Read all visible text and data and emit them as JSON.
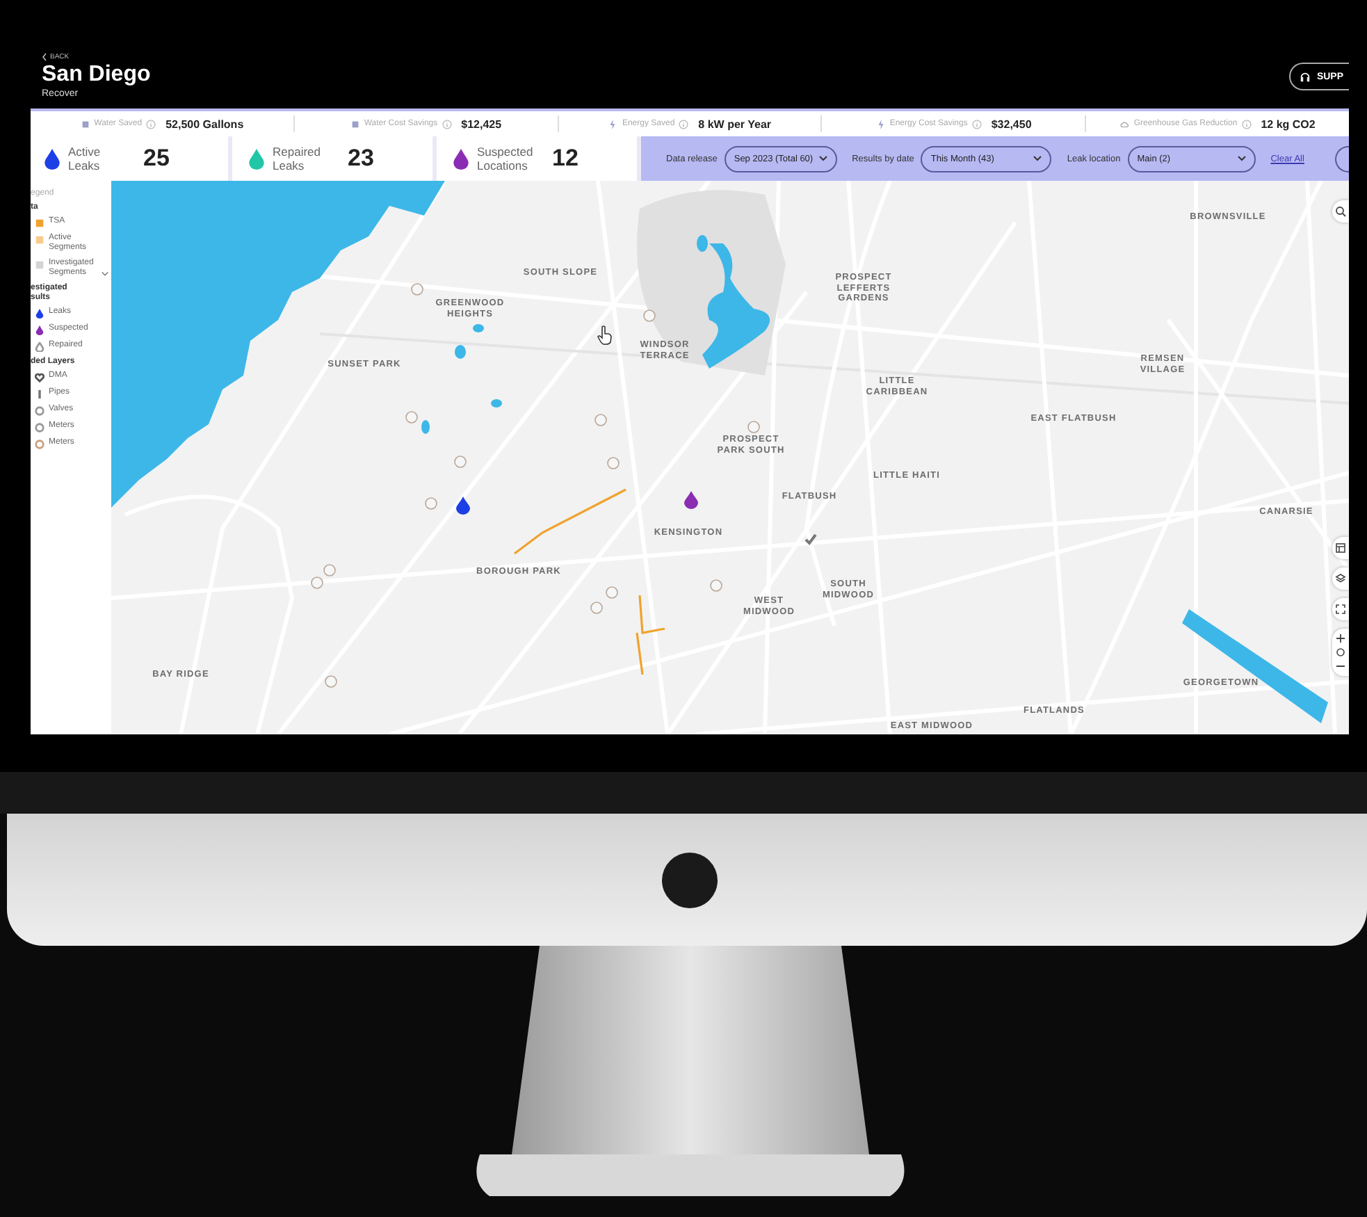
{
  "header": {
    "back_label": "BACK",
    "title": "San Diego",
    "subtitle": "Recover",
    "support_label": "SUPP"
  },
  "stats": [
    {
      "kind": "square",
      "label": "Water Saved",
      "value": "52,500 Gallons"
    },
    {
      "kind": "square",
      "label": "Water Cost Savings",
      "value": "$12,425"
    },
    {
      "kind": "bolt",
      "label": "Energy Saved",
      "value": "8 kW per Year"
    },
    {
      "kind": "bolt",
      "label": "Energy Cost Savings",
      "value": "$32,450"
    },
    {
      "kind": "cloud",
      "label": "Greenhouse Gas Reduction",
      "value": "12 kg CO2"
    }
  ],
  "counts": [
    {
      "label": "Active Leaks",
      "value": "25",
      "color": "#1d3fe6"
    },
    {
      "label": "Repaired Leaks",
      "value": "23",
      "color": "#1fc7a6"
    },
    {
      "label": "Suspected Locations",
      "value": "12",
      "color": "#8a2db3"
    }
  ],
  "filters": [
    {
      "label": "Data release",
      "value": "Sep 2023 (Total 60)"
    },
    {
      "label": "Results by date",
      "value": "This Month (43)"
    },
    {
      "label": "Leak location",
      "value": "Main (2)"
    }
  ],
  "clear_label": "Clear All",
  "legend": {
    "title": "egend",
    "sections": [
      {
        "heading": "ta",
        "items": [
          {
            "kind": "swatch",
            "label": "TSA",
            "color": "#f0a22e"
          },
          {
            "kind": "swatch",
            "label": "Active Segments",
            "color": "#f6cc8c"
          },
          {
            "kind": "swatch",
            "label": "Investigated Segments",
            "color": "#d4d4d4",
            "expandable": true
          }
        ]
      },
      {
        "heading": "estigated sults",
        "items": [
          {
            "kind": "drop",
            "label": "Leaks",
            "color": "#1d3fe6"
          },
          {
            "kind": "drop",
            "label": "Suspected",
            "color": "#8a2db3"
          },
          {
            "kind": "drop-outline",
            "label": "Repaired",
            "color": "#9a9a9a"
          }
        ]
      },
      {
        "heading": "ded Layers",
        "items": [
          {
            "kind": "outline",
            "label": "DMA",
            "color": "#555555"
          },
          {
            "kind": "pipe",
            "label": "Pipes",
            "color": "#777777"
          },
          {
            "kind": "circle",
            "label": "Valves",
            "color": "#999999"
          },
          {
            "kind": "circle",
            "label": "Meters",
            "color": "#999999"
          },
          {
            "kind": "circle",
            "label": "Meters",
            "color": "#c9a080"
          }
        ]
      }
    ]
  },
  "map": {
    "labels": [
      "SOUTH SLOPE",
      "GREENWOOD HEIGHTS",
      "SUNSET PARK",
      "WINDSOR TERRACE",
      "PROSPECT LEFFERTS GARDENS",
      "BROWNSVILLE",
      "REMSEN VILLAGE",
      "LITTLE CARIBBEAN",
      "EAST FLATBUSH",
      "PROSPECT PARK SOUTH",
      "LITTLE HAITI",
      "FLATBUSH",
      "KENSINGTON",
      "CANARSIE",
      "BOROUGH PARK",
      "SOUTH MIDWOOD",
      "WEST MIDWOOD",
      "BAY RIDGE",
      "GEORGETOWN",
      "FLATLANDS",
      "EAST MIDWOOD"
    ],
    "markers": [
      {
        "kind": "leak",
        "color": "#1d3fe6"
      },
      {
        "kind": "leak",
        "color": "#8a2db3"
      },
      {
        "kind": "check",
        "color": "#777777"
      }
    ]
  }
}
